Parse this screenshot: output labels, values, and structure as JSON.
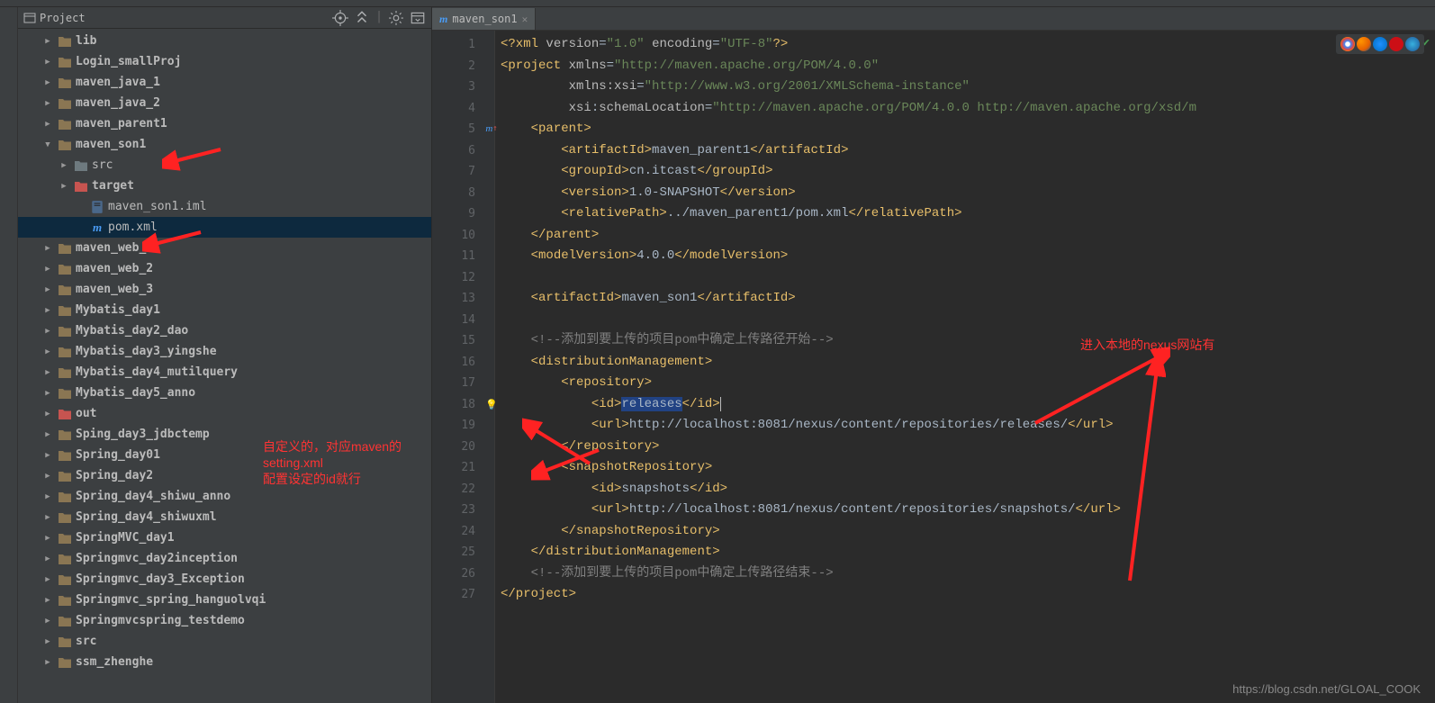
{
  "sidebar": {
    "title": "Project",
    "items": [
      {
        "label": "lib",
        "type": "folder",
        "color": "#8a7653",
        "indent": 1,
        "arrow": "▶",
        "bold": true
      },
      {
        "label": "Login_smallProj",
        "type": "folder",
        "color": "#8a7653",
        "indent": 1,
        "arrow": "▶",
        "bold": true
      },
      {
        "label": "maven_java_1",
        "type": "folder",
        "color": "#8a7653",
        "indent": 1,
        "arrow": "▶",
        "bold": true
      },
      {
        "label": "maven_java_2",
        "type": "folder",
        "color": "#8a7653",
        "indent": 1,
        "arrow": "▶",
        "bold": true
      },
      {
        "label": "maven_parent1",
        "type": "folder",
        "color": "#8a7653",
        "indent": 1,
        "arrow": "▶",
        "bold": true
      },
      {
        "label": "maven_son1",
        "type": "folder",
        "color": "#8a7653",
        "indent": 1,
        "arrow": "▼",
        "bold": true
      },
      {
        "label": "src",
        "type": "folder",
        "color": "#6e7a7f",
        "indent": 2,
        "arrow": "▶",
        "bold": false
      },
      {
        "label": "target",
        "type": "folder",
        "color": "#c75450",
        "indent": 2,
        "arrow": "▶",
        "bold": true
      },
      {
        "label": "maven_son1.iml",
        "type": "iml",
        "indent": 3,
        "arrow": "",
        "bold": false
      },
      {
        "label": "pom.xml",
        "type": "maven",
        "indent": 3,
        "arrow": "",
        "bold": false,
        "selected": true
      },
      {
        "label": "maven_web_1",
        "type": "folder",
        "color": "#8a7653",
        "indent": 1,
        "arrow": "▶",
        "bold": true
      },
      {
        "label": "maven_web_2",
        "type": "folder",
        "color": "#8a7653",
        "indent": 1,
        "arrow": "▶",
        "bold": true
      },
      {
        "label": "maven_web_3",
        "type": "folder",
        "color": "#8a7653",
        "indent": 1,
        "arrow": "▶",
        "bold": true
      },
      {
        "label": "Mybatis_day1",
        "type": "folder",
        "color": "#8a7653",
        "indent": 1,
        "arrow": "▶",
        "bold": true
      },
      {
        "label": "Mybatis_day2_dao",
        "type": "folder",
        "color": "#8a7653",
        "indent": 1,
        "arrow": "▶",
        "bold": true
      },
      {
        "label": "Mybatis_day3_yingshe",
        "type": "folder",
        "color": "#8a7653",
        "indent": 1,
        "arrow": "▶",
        "bold": true
      },
      {
        "label": "Mybatis_day4_mutilquery",
        "type": "folder",
        "color": "#8a7653",
        "indent": 1,
        "arrow": "▶",
        "bold": true
      },
      {
        "label": "Mybatis_day5_anno",
        "type": "folder",
        "color": "#8a7653",
        "indent": 1,
        "arrow": "▶",
        "bold": true
      },
      {
        "label": "out",
        "type": "folder",
        "color": "#c75450",
        "indent": 1,
        "arrow": "▶",
        "bold": true
      },
      {
        "label": "Sping_day3_jdbctemp",
        "type": "folder",
        "color": "#8a7653",
        "indent": 1,
        "arrow": "▶",
        "bold": true
      },
      {
        "label": "Spring_day01",
        "type": "folder",
        "color": "#8a7653",
        "indent": 1,
        "arrow": "▶",
        "bold": true
      },
      {
        "label": "Spring_day2",
        "type": "folder",
        "color": "#8a7653",
        "indent": 1,
        "arrow": "▶",
        "bold": true
      },
      {
        "label": "Spring_day4_shiwu_anno",
        "type": "folder",
        "color": "#8a7653",
        "indent": 1,
        "arrow": "▶",
        "bold": true
      },
      {
        "label": "Spring_day4_shiwuxml",
        "type": "folder",
        "color": "#8a7653",
        "indent": 1,
        "arrow": "▶",
        "bold": true
      },
      {
        "label": "SpringMVC_day1",
        "type": "folder",
        "color": "#8a7653",
        "indent": 1,
        "arrow": "▶",
        "bold": true
      },
      {
        "label": "Springmvc_day2inception",
        "type": "folder",
        "color": "#8a7653",
        "indent": 1,
        "arrow": "▶",
        "bold": true
      },
      {
        "label": "Springmvc_day3_Exception",
        "type": "folder",
        "color": "#8a7653",
        "indent": 1,
        "arrow": "▶",
        "bold": true
      },
      {
        "label": "Springmvc_spring_hanguolvqi",
        "type": "folder",
        "color": "#8a7653",
        "indent": 1,
        "arrow": "▶",
        "bold": true
      },
      {
        "label": "Springmvcspring_testdemo",
        "type": "folder",
        "color": "#8a7653",
        "indent": 1,
        "arrow": "▶",
        "bold": true
      },
      {
        "label": "src",
        "type": "folder",
        "color": "#8a7653",
        "indent": 1,
        "arrow": "▶",
        "bold": true
      },
      {
        "label": "ssm_zhenghe",
        "type": "folder",
        "color": "#8a7653",
        "indent": 1,
        "arrow": "▶",
        "bold": true
      }
    ]
  },
  "editor": {
    "tab_label": "maven_son1",
    "line_start": 1,
    "line_end": 27
  },
  "annotations": {
    "text1_line1": "自定义的，对应maven的setting.xml",
    "text1_line2": "配置设定的id就行",
    "text2": "进入本地的nexus网站有"
  },
  "watermark": "https://blog.csdn.net/GLOAL_COOK"
}
